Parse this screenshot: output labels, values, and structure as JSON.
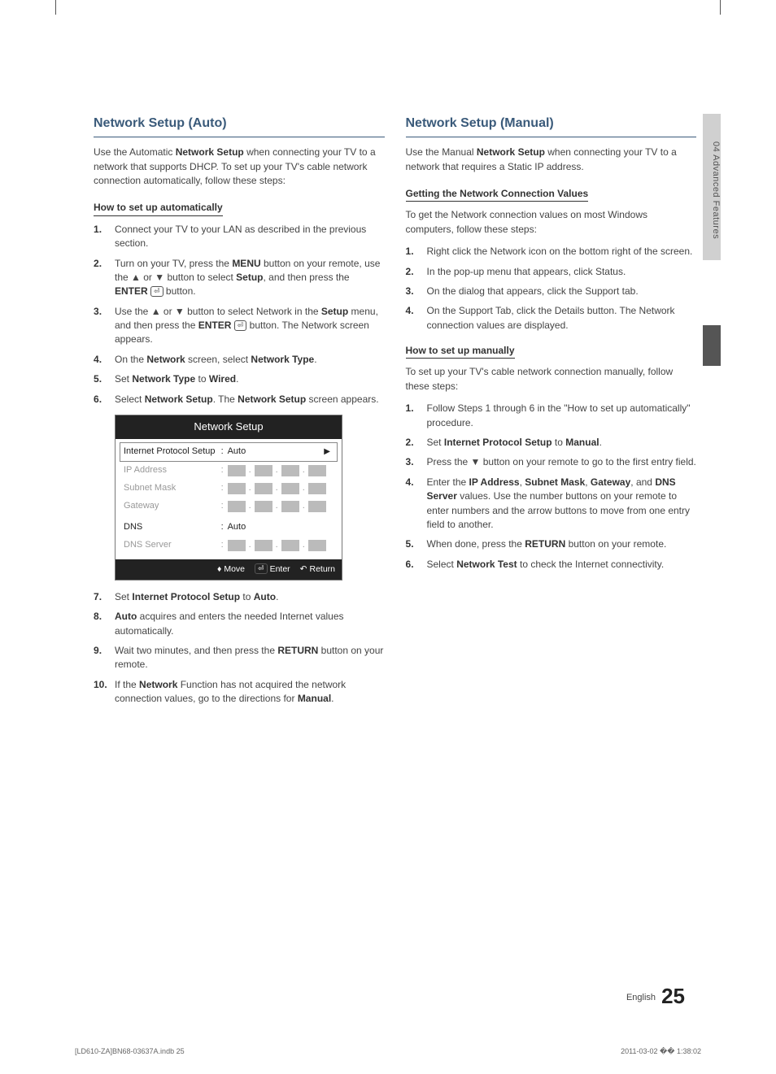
{
  "side_tab": "04   Advanced Features",
  "left": {
    "heading": "Network Setup (Auto)",
    "intro_pre": "Use the Automatic ",
    "intro_bold": "Network Setup",
    "intro_post": " when connecting your TV to a network that supports DHCP. To set up your TV's cable network connection automatically, follow these steps:",
    "sub1": "How to set up automatically",
    "s1": "Connect your TV to your LAN as described in the previous section.",
    "s2a": "Turn on your TV, press the ",
    "s2_menu": "MENU",
    "s2b": " button on your remote, use the ▲ or ▼ button to select ",
    "s2_setup": "Setup",
    "s2c": ", and then press the ",
    "s2_enter": "ENTER",
    "s2d": " button.",
    "s3a": "Use the ▲ or ▼ button to select Network in the ",
    "s3_setup": "Setup",
    "s3b": " menu, and then press the ",
    "s3_enter": "ENTER",
    "s3c": " button. The Network screen appears.",
    "s4a": "On the ",
    "s4_network": "Network",
    "s4b": " screen, select ",
    "s4_nt": "Network Type",
    "s4c": ".",
    "s5a": "Set ",
    "s5_nt": "Network Type",
    "s5b": " to ",
    "s5_wired": "Wired",
    "s5c": ".",
    "s6a": "Select ",
    "s6_ns": "Network Setup",
    "s6b": ". The ",
    "s6_ns2": "Network Setup",
    "s6c": " screen appears.",
    "s7a": "Set ",
    "s7_ips": "Internet Protocol Setup",
    "s7b": " to ",
    "s7_auto": "Auto",
    "s7c": ".",
    "s8a_bold": "Auto",
    "s8b": " acquires and enters the needed Internet values automatically.",
    "s9a": "Wait two minutes, and then press the ",
    "s9_ret": "RETURN",
    "s9b": " button on your remote.",
    "s10a": "If the ",
    "s10_net": "Network",
    "s10b": " Function has not acquired the network connection values, go to the directions for ",
    "s10_man": "Manual",
    "s10c": "."
  },
  "ui": {
    "title": "Network Setup",
    "rows": {
      "ips": "Internet Protocol Setup",
      "ips_val": "Auto",
      "ip": "IP Address",
      "subnet": "Subnet Mask",
      "gateway": "Gateway",
      "dns": "DNS",
      "dns_val": "Auto",
      "dns_server": "DNS Server"
    },
    "footer": {
      "move": "Move",
      "enter": "Enter",
      "return": "Return"
    }
  },
  "right": {
    "heading": "Network Setup (Manual)",
    "intro_pre": "Use the Manual ",
    "intro_bold": "Network Setup",
    "intro_post": " when connecting your TV to a network that requires a Static IP address.",
    "sub1": "Getting the Network Connection Values",
    "p1": "To get the Network connection values on most Windows computers, follow these steps:",
    "g1": "Right click the Network icon on the bottom right of the screen.",
    "g2": "In the pop-up menu that appears, click Status.",
    "g3": "On the dialog that appears, click the Support tab.",
    "g4": "On the Support Tab, click the Details button. The Network connection values are displayed.",
    "sub2": "How to set up manually",
    "p2": "To set up your TV's cable network connection manually, follow these steps:",
    "m1": "Follow Steps 1 through 6 in the \"How to set up automatically\" procedure.",
    "m2a": "Set ",
    "m2_ips": "Internet Protocol Setup",
    "m2b": " to ",
    "m2_man": "Manual",
    "m2c": ".",
    "m3": "Press the ▼ button on your remote to go to the first entry field.",
    "m4a": "Enter the ",
    "m4_ip": "IP Address",
    "m4b": ", ",
    "m4_sub": "Subnet Mask",
    "m4c": ", ",
    "m4_gw": "Gateway",
    "m4d": ", and ",
    "m4_dns": "DNS Server",
    "m4e": " values. Use the number buttons on your remote to enter numbers and the arrow buttons to move from one entry field to another.",
    "m5a": "When done, press the ",
    "m5_ret": "RETURN",
    "m5b": " button on your remote.",
    "m6a": "Select ",
    "m6_nt": "Network Test",
    "m6b": " to check the Internet connectivity."
  },
  "footer": {
    "lang": "English",
    "page": "25",
    "file": "[LD610-ZA]BN68-03637A.indb   25",
    "stamp": "2011-03-02   �� 1:38:02"
  }
}
